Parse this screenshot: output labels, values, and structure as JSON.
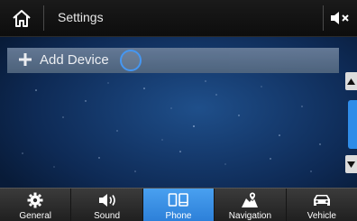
{
  "header": {
    "title": "Settings"
  },
  "list": {
    "add_device_label": "Add Device"
  },
  "tabs": [
    {
      "label": "General",
      "icon": "gear-icon",
      "active": false
    },
    {
      "label": "Sound",
      "icon": "speaker-icon",
      "active": false
    },
    {
      "label": "Phone",
      "icon": "phone-icon",
      "active": true
    },
    {
      "label": "Navigation",
      "icon": "map-pin-icon",
      "active": false
    },
    {
      "label": "Vehicle",
      "icon": "car-icon",
      "active": false
    }
  ],
  "colors": {
    "accent": "#2f8ce8",
    "header_bg": "#111111",
    "background": "#163c70"
  }
}
